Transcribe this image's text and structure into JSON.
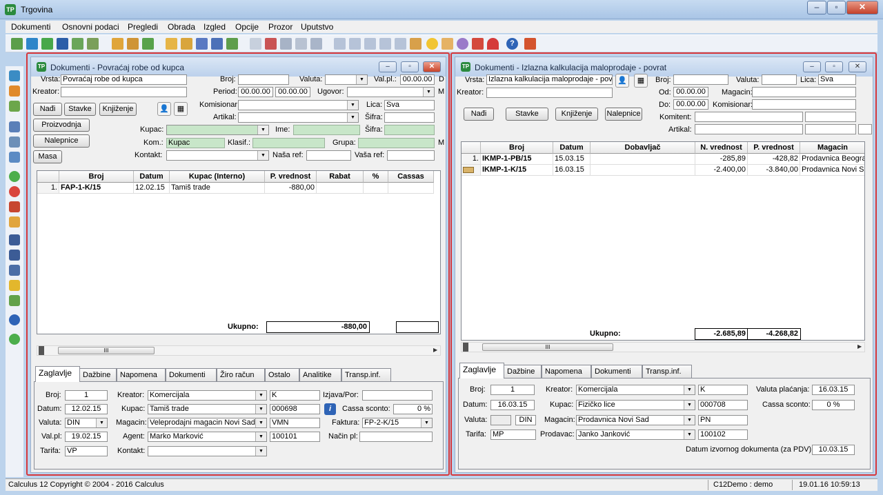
{
  "app": {
    "title": "Trgovina",
    "icon_text": "TP"
  },
  "menu": [
    "Dokumenti",
    "Osnovni podaci",
    "Pregledi",
    "Obrada",
    "Izgled",
    "Opcije",
    "Prozor",
    "Uputstvo"
  ],
  "status": {
    "copyright": "Calculus 12  Copyright © 2004 - 2016  Calculus",
    "user": "C12Demo : demo",
    "datetime": "19.01.16 10:59:13"
  },
  "left": {
    "title": "Dokumenti - Povraćaj robe od kupca",
    "filter": {
      "vrsta_label": "Vrsta:",
      "vrsta": "Povraćaj robe od kupca",
      "broj_label": "Broj:",
      "valuta_label": "Valuta:",
      "valpl_label": "Val.pl.:",
      "valpl": "00.00.00",
      "d_label": "D",
      "kreator_label": "Kreator:",
      "period_label": "Period:",
      "period_od": "00.00.00",
      "period_do": "00.00.00",
      "ugovor_label": "Ugovor:",
      "m_label": "M",
      "komisionar_label": "Komisionar:",
      "lica_label": "Lica:",
      "lica": "Sva",
      "artikal_label": "Artikal:",
      "sifra_label": "Šifra:",
      "kupac_label": "Kupac:",
      "ime_label": "Ime:",
      "sifra2_label": "Šifra:",
      "kom_label": "Kom.:",
      "kom": "Kupac",
      "klasif_label": "Klasif.:",
      "grupa_label": "Grupa:",
      "m2_label": "M",
      "kontakt_label": "Kontakt:",
      "nasaref_label": "Naša ref:",
      "vasaref_label": "Vaša ref:"
    },
    "buttons": {
      "nadji": "Nađi",
      "stavke": "Stavke",
      "knjizenje": "Knjiženje",
      "proizvodnja": "Proizvodnja",
      "nalepnice": "Nalepnice",
      "masa": "Masa"
    },
    "grid": {
      "columns": [
        "Broj",
        "Datum",
        "Kupac (Interno)",
        "P. vrednost",
        "Rabat",
        "%",
        "Cassas"
      ],
      "rows": [
        {
          "n": "1.",
          "broj": "FAP-1-K/15",
          "datum": "12.02.15",
          "kupac": "Tamiš trade",
          "pvrednost": "-880,00"
        }
      ],
      "total_label": "Ukupno:",
      "total": "-880,00"
    },
    "tabs": [
      "Zaglavlje",
      "Dažbine",
      "Napomena",
      "Dokumenti",
      "Žiro račun",
      "Ostalo",
      "Analitike",
      "Transp.inf."
    ],
    "detail": {
      "broj_label": "Broj:",
      "broj": "1",
      "kreator_label": "Kreator:",
      "kreator": "Komercijala",
      "kreator_code": "K",
      "izjava_label": "Izjava/Por:",
      "datum_label": "Datum:",
      "datum": "12.02.15",
      "kupac_label": "Kupac:",
      "kupac": "Tamiš trade",
      "kupac_code": "000698",
      "cassa_label": "Cassa sconto:",
      "cassa": "0 %",
      "valuta_label": "Valuta:",
      "valuta": "DIN",
      "magacin_label": "Magacin:",
      "magacin": "Veleprodajni magacin Novi Sad",
      "magacin_code": "VMN",
      "faktura_label": "Faktura:",
      "faktura": "FP-2-K/15",
      "valpl_label": "Val.pl:",
      "valpl": "19.02.15",
      "agent_label": "Agent:",
      "agent": "Marko Marković",
      "agent_code": "100101",
      "nacin_label": "Način pl:",
      "tarifa_label": "Tarifa:",
      "tarifa": "VP",
      "kontakt_label": "Kontakt:",
      "info": "i"
    }
  },
  "right": {
    "title": "Dokumenti - Izlazna kalkulacija maloprodaje - povrat",
    "filter": {
      "vrsta_label": "Vrsta:",
      "vrsta": "Izlazna kalkulacija maloprodaje - povra",
      "broj_label": "Broj:",
      "valuta_label": "Valuta:",
      "lica_label": "Lica:",
      "lica": "Sva",
      "kreator_label": "Kreator:",
      "od_label": "Od:",
      "od": "00.00.00",
      "magacin_label": "Magacin:",
      "do_label": "Do:",
      "do": "00.00.00",
      "komisionar_label": "Komisionar:",
      "komitent_label": "Komitent:",
      "artikal_label": "Artikal:"
    },
    "buttons": {
      "nadji": "Nađi",
      "stavke": "Stavke",
      "knjizenje": "Knjiženje",
      "nalepnice": "Nalepnice"
    },
    "grid": {
      "columns": [
        "Broj",
        "Datum",
        "Dobavljač",
        "N. vrednost",
        "P. vrednost",
        "Magacin"
      ],
      "rows": [
        {
          "n": "1.",
          "broj": "IKMP-1-PB/15",
          "datum": "15.03.15",
          "dobavljac": "",
          "nvrednost": "-285,89",
          "pvrednost": "-428,82",
          "magacin": "Prodavnica Beograd"
        },
        {
          "n": "",
          "broj": "IKMP-1-K/15",
          "datum": "16.03.15",
          "dobavljac": "",
          "nvrednost": "-2.400,00",
          "pvrednost": "-3.840,00",
          "magacin": "Prodavnica Novi Sad"
        }
      ],
      "total_label": "Ukupno:",
      "total_n": "-2.685,89",
      "total_p": "-4.268,82"
    },
    "tabs": [
      "Zaglavlje",
      "Dažbine",
      "Napomena",
      "Dokumenti",
      "Transp.inf."
    ],
    "detail": {
      "broj_label": "Broj:",
      "broj": "1",
      "kreator_label": "Kreator:",
      "kreator": "Komercijala",
      "kreator_code": "K",
      "valuta_placanja_label": "Valuta plaćanja:",
      "valuta_placanja": "16.03.15",
      "datum_label": "Datum:",
      "datum": "16.03.15",
      "kupac_label": "Kupac:",
      "kupac": "Fizičko lice",
      "kupac_code": "000708",
      "cassa_label": "Cassa sconto:",
      "cassa": "0 %",
      "valuta_label": "Valuta:",
      "valuta": "DIN",
      "magacin_label": "Magacin:",
      "magacin": "Prodavnica Novi Sad",
      "magacin_code": "PN",
      "tarifa_label": "Tarifa:",
      "tarifa": "MP",
      "prodavac_label": "Prodavac:",
      "prodavac": "Janko Janković",
      "prodavac_code": "100102",
      "datum_izvornog_label": "Datum izvornog dokumenta (za PDV):",
      "datum_izvornog": "10.03.15"
    }
  },
  "colors": {
    "highlight": "#d6363a",
    "green_field": "#c8e6c9",
    "title_bar": "#bcd1ec"
  }
}
